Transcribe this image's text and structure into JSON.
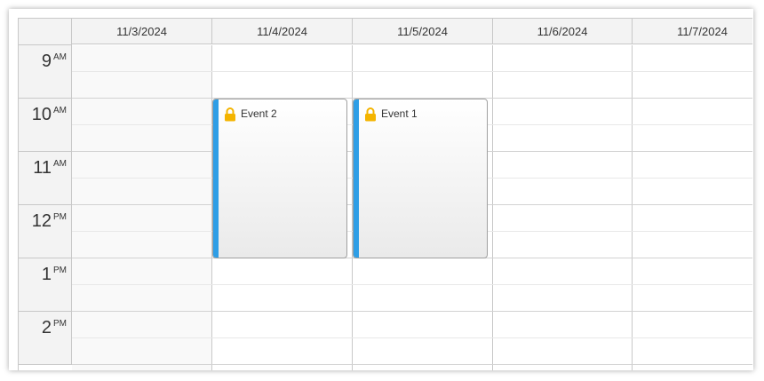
{
  "calendar": {
    "days": [
      "11/3/2024",
      "11/4/2024",
      "11/5/2024",
      "11/6/2024",
      "11/7/2024"
    ],
    "hours": [
      {
        "hour": "9",
        "ampm": "AM"
      },
      {
        "hour": "10",
        "ampm": "AM"
      },
      {
        "hour": "11",
        "ampm": "AM"
      },
      {
        "hour": "12",
        "ampm": "PM"
      },
      {
        "hour": "1",
        "ampm": "PM"
      },
      {
        "hour": "2",
        "ampm": "PM"
      }
    ],
    "events": [
      {
        "title": "Event 2",
        "date": "11/4/2024",
        "start": "10:00 AM",
        "end": "1:00 PM",
        "icon": "lock-icon",
        "bar_color": "#2e9ee6"
      },
      {
        "title": "Event 1",
        "date": "11/5/2024",
        "start": "10:00 AM",
        "end": "1:00 PM",
        "icon": "lock-icon",
        "bar_color": "#2e9ee6"
      }
    ]
  },
  "colors": {
    "header_bg": "#f3f3f3",
    "grid_line": "#c8c8c8",
    "event_bar": "#2e9ee6",
    "lock_icon": "#f4b400"
  }
}
